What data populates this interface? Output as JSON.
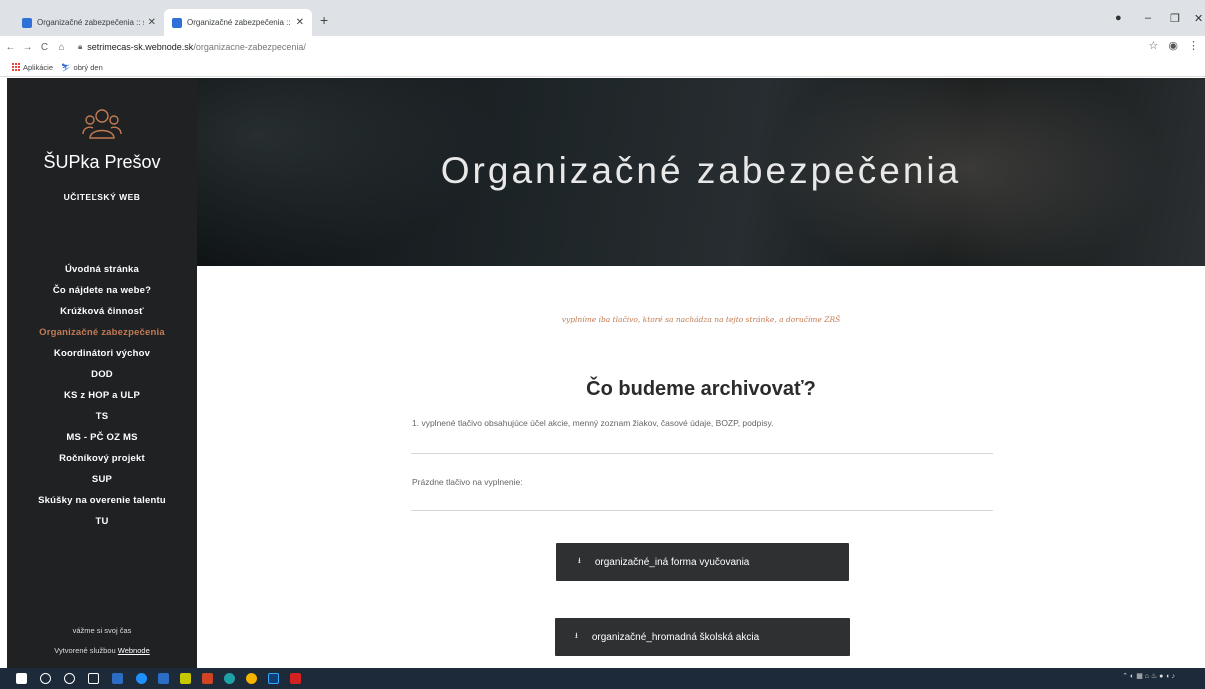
{
  "browser": {
    "tabs": [
      {
        "label": "Organizačné zabezpečenia :: setr"
      },
      {
        "label": "Organizačné zabezpečenia :: setr"
      }
    ],
    "url_host": "setrimecas-sk.webnode.sk",
    "url_path": "/organizacne-zabezpecenia/",
    "bookmarks": [
      {
        "label": "Aplikácie"
      },
      {
        "label": "obrý den"
      }
    ]
  },
  "sidebar": {
    "site_title": "ŠUPka Prešov",
    "subtitle": "UČITEĽSKÝ WEB",
    "nav": [
      {
        "label": "Úvodná stránka"
      },
      {
        "label": "Čo nájdete na webe?"
      },
      {
        "label": "Krúžková činnosť"
      },
      {
        "label": "Organizačné zabezpečenia"
      },
      {
        "label": "Koordinátori výchov"
      },
      {
        "label": "DOD"
      },
      {
        "label": "KS z HOP a ULP"
      },
      {
        "label": "TS"
      },
      {
        "label": "MS - PČ OZ MS"
      },
      {
        "label": "Ročníkový projekt"
      },
      {
        "label": "SUP"
      },
      {
        "label": "Skúšky na overenie talentu"
      },
      {
        "label": "TU"
      }
    ],
    "active_index": 3,
    "footer_text": "vážme si svoj čas",
    "footer_credit_prefix": "Vytvorené službou",
    "footer_credit_link": "Webnode"
  },
  "hero": {
    "title": "Organizačné zabezpečenia"
  },
  "content": {
    "intro": "vyplníme iba tlačivo, ktoré sa nachádza na tejto stránke, a doručíme ZRŠ",
    "heading": "Čo budeme archivovať?",
    "paragraph1": "1. vyplnené tlačivo obsahujúce účel akcie, menný zoznam žiakov, časové údaje, BOZP, podpisy.",
    "paragraph2": "Prázdne tlačivo na vyplnenie:",
    "downloads": [
      {
        "label": "organizačné_iná forma vyučovania"
      },
      {
        "label": "organizačné_hromadná školská akcia"
      }
    ]
  },
  "colors": {
    "accent": "#c27b53",
    "sidebar_bg": "#1f2123",
    "button_bg": "#2f3032"
  }
}
